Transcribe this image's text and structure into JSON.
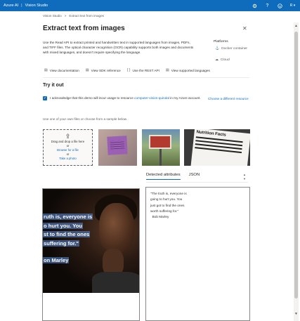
{
  "topbar": {
    "brand_left": "Azure AI",
    "brand_right": "Vision Studio",
    "icons": [
      "gear-icon",
      "help-icon",
      "smiley-icon",
      "account-icon"
    ]
  },
  "breadcrumb": {
    "root": "Vision Studio",
    "sep": ">",
    "current": "Extract text from images"
  },
  "header": {
    "title": "Extract text from images",
    "description": "Use the Read API to extract printed and handwritten text in supported languages from images, PDFs, and TIFF files. The optical character recognition (OCR) capability supports both images and documents with mixed languages, and doesn't require specifying the language."
  },
  "platforms": {
    "heading": "Platforms",
    "options": [
      "Docker container",
      "Cloud"
    ]
  },
  "links": [
    "View documentation",
    "View SDK reference",
    "Use the REST API",
    "View supported languages"
  ],
  "try_it": {
    "title": "Try it out",
    "ack_prefix": "I acknowledge that this demo will incur usage to resource",
    "ack_resource": "computer-vision-quindal",
    "ack_suffix": "in my Azure account.",
    "different_resource": "Choose a different resource",
    "use_one": "Use one of your own files or choose from a sample below."
  },
  "upload": {
    "line1": "Drag and drop a file here",
    "line2": "or",
    "browse": "Browse for a file",
    "line3": "or",
    "photo": "Take a photo"
  },
  "sample3_label": "Nutrition Facts",
  "image_quote": {
    "lines": [
      "ruth is, everyone is",
      "o hurt you. You",
      "st to find the ones",
      "suffering for.\""
    ],
    "name": "on Marley"
  },
  "tabs": {
    "active": "Detected attributes",
    "other": "JSON"
  },
  "result_lines": [
    "\"The truth is, everyone is",
    "going to hurt you. You",
    "just got to find the ones",
    "worth suffering for.\"",
    "  Bob Marley"
  ]
}
